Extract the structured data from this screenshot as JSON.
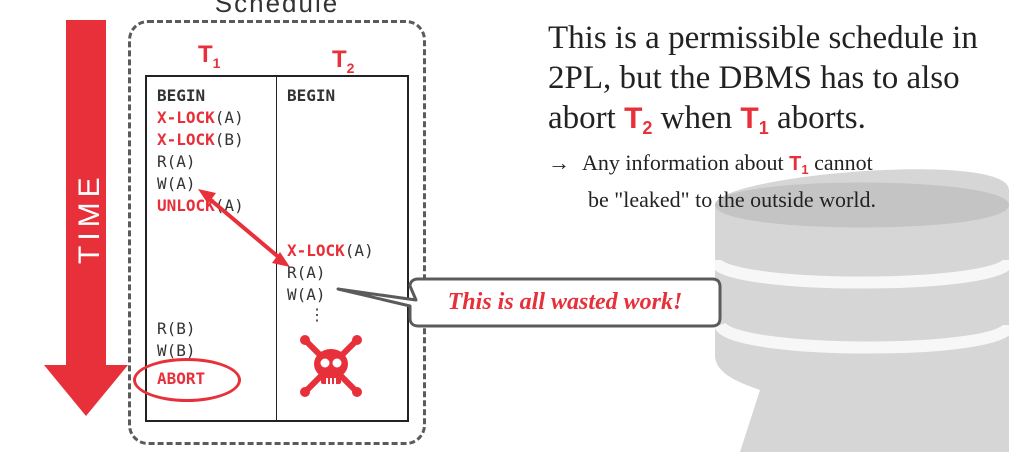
{
  "schedule": {
    "title": "Schedule",
    "t1_label": "T",
    "t1_sub": "1",
    "t2_label": "T",
    "t2_sub": "2",
    "t1_ops": [
      {
        "kw": "",
        "plain": "BEGIN",
        "bold": true
      },
      {
        "kw": "X-LOCK",
        "plain": "(A)"
      },
      {
        "kw": "X-LOCK",
        "plain": "(B)"
      },
      {
        "kw": "",
        "plain": "R(A)"
      },
      {
        "kw": "",
        "plain": "W(A)"
      },
      {
        "kw": "UNLOCK",
        "plain": "(A)"
      },
      {
        "kw": "",
        "plain": "R(B)"
      },
      {
        "kw": "",
        "plain": "W(B)"
      },
      {
        "kw": "ABORT",
        "plain": ""
      }
    ],
    "t2_ops": [
      {
        "kw": "",
        "plain": "BEGIN",
        "bold": true
      },
      {
        "kw": "X-LOCK",
        "plain": "(A)"
      },
      {
        "kw": "",
        "plain": "R(A)"
      },
      {
        "kw": "",
        "plain": "W(A)"
      },
      {
        "kw": "",
        "plain": "⋮"
      }
    ]
  },
  "time_label": "TIME",
  "prose": {
    "line1": "This is a permissible schedule in",
    "line2": "2PL, but the DBMS has to also",
    "line3_a": "abort ",
    "line3_t": "T",
    "line3_tsub": "2",
    "line3_b": " when ",
    "line3_t2": "T",
    "line3_t2sub": "1",
    "line3_c": " aborts.",
    "bullet_arrow": "→",
    "bullet_a": "Any information about ",
    "bullet_t": "T",
    "bullet_tsub": "1",
    "bullet_b": " cannot",
    "bullet_line2": "be \"leaked\" to the outside world."
  },
  "callout": "This is all wasted work!",
  "icons": {
    "skull": "skull-crossbones-icon",
    "db": "database-cylinder-icon"
  },
  "colors": {
    "accent": "#e8303a",
    "text": "#222222",
    "bg_cylinder": "#cfcfcf"
  }
}
